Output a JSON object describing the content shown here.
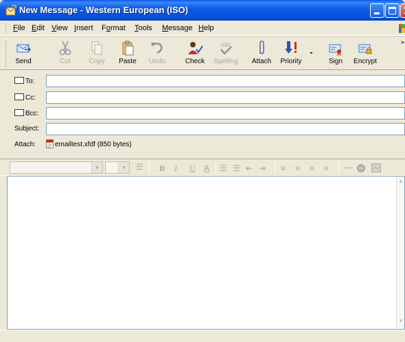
{
  "window": {
    "title": "New Message - Western European (ISO)"
  },
  "menu": [
    {
      "label": "File",
      "key": "F",
      "rest": "ile"
    },
    {
      "label": "Edit",
      "key": "E",
      "rest": "dit"
    },
    {
      "label": "View",
      "key": "V",
      "rest": "iew"
    },
    {
      "label": "Insert",
      "key": "I",
      "rest": "nsert"
    },
    {
      "label": "Format",
      "key": "o",
      "pre": "F",
      "rest": "rmat"
    },
    {
      "label": "Tools",
      "key": "T",
      "rest": "ools"
    },
    {
      "label": "Message",
      "key": "M",
      "rest": "essage"
    },
    {
      "label": "Help",
      "key": "H",
      "rest": "elp"
    }
  ],
  "toolbar": {
    "send": "Send",
    "cut": "Cut",
    "copy": "Copy",
    "paste": "Paste",
    "undo": "Undo",
    "check": "Check",
    "spelling": "Spelling",
    "attach": "Attach",
    "priority": "Priority",
    "sign": "Sign",
    "encrypt": "Encrypt"
  },
  "fields": {
    "to_label": "To:",
    "to_value": "",
    "cc_label": "Cc:",
    "cc_value": "",
    "bcc_label": "Bcc:",
    "bcc_value": "",
    "subject_label": "Subject:",
    "subject_value": "",
    "attach_label": "Attach:",
    "attachment": "emailtest.xfdf (850 bytes)"
  },
  "format_toolbar": {
    "bold": "B",
    "italic": "I",
    "underline": "U",
    "font_color": "A"
  },
  "colors": {
    "titlebar": "#0650d7",
    "accent_blue": "#3b74d8",
    "priority_red": "#d42b1a"
  }
}
